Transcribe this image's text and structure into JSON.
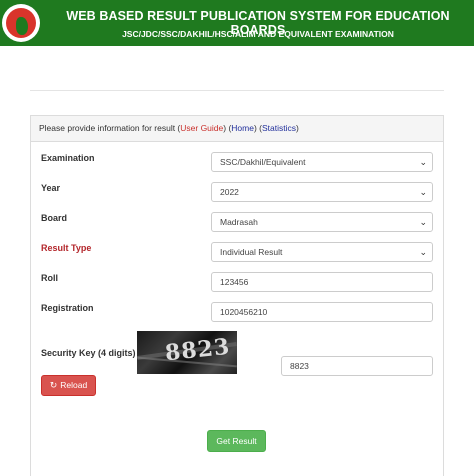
{
  "header": {
    "title": "WEB BASED RESULT PUBLICATION SYSTEM FOR EDUCATION BOARDS",
    "subtitle": "JSC/JDC/SSC/DAKHIL/HSC/ALIM AND EQUIVALENT EXAMINATION",
    "logo_icon": "bangladesh-govt-seal-icon"
  },
  "panel": {
    "intro": "Please provide information for result (",
    "user_guide": "User Guide",
    "mid1": ") (",
    "home": "Home",
    "mid2": ") (",
    "statistics": "Statistics",
    "end": ")"
  },
  "form": {
    "examination": {
      "label": "Examination",
      "value": "SSC/Dakhil/Equivalent"
    },
    "year": {
      "label": "Year",
      "value": "2022"
    },
    "board": {
      "label": "Board",
      "value": "Madrasah"
    },
    "result_type": {
      "label": "Result Type",
      "value": "Individual Result"
    },
    "roll": {
      "label": "Roll",
      "value": "123456"
    },
    "registration": {
      "label": "Registration",
      "value": "1020456210"
    },
    "security": {
      "label": "Security Key (4 digits)",
      "captcha": "8823",
      "value": "8823"
    },
    "reload_label": "Reload",
    "submit_label": "Get Result"
  },
  "colors": {
    "header_bg": "#1f7a1f",
    "link_red": "#c9302c",
    "link_blue": "#22309c",
    "reload_bg": "#d9534f",
    "submit_bg": "#5cb85c"
  }
}
